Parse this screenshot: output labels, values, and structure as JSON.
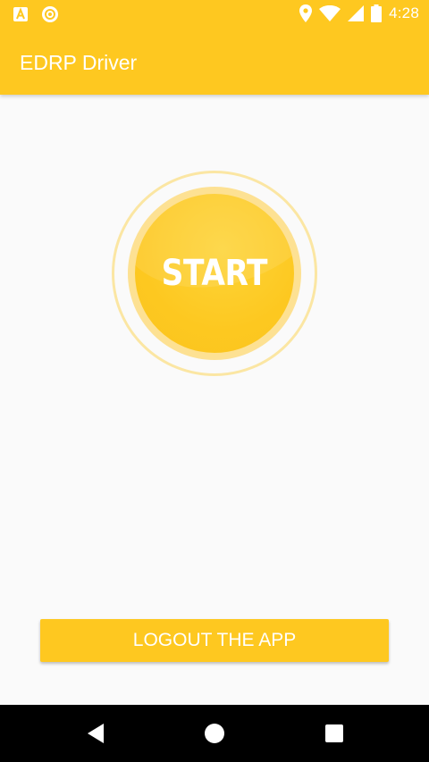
{
  "status_bar": {
    "time": "4:28",
    "left_icons": [
      "android-debug-icon",
      "sync-circle-icon"
    ],
    "right_icons": [
      "location-pin-icon",
      "wifi-icon",
      "cell-signal-icon",
      "battery-icon"
    ]
  },
  "app_bar": {
    "title": "EDRP Driver"
  },
  "main": {
    "start_label": "START",
    "logout_label": "LOGOUT THE APP"
  },
  "nav_bar": {
    "icons": [
      "back-icon",
      "home-icon",
      "recents-icon"
    ]
  },
  "colors": {
    "accent": "#fec820",
    "background": "#fafafa",
    "ring": "#fbe6a3",
    "nav": "#000000"
  }
}
